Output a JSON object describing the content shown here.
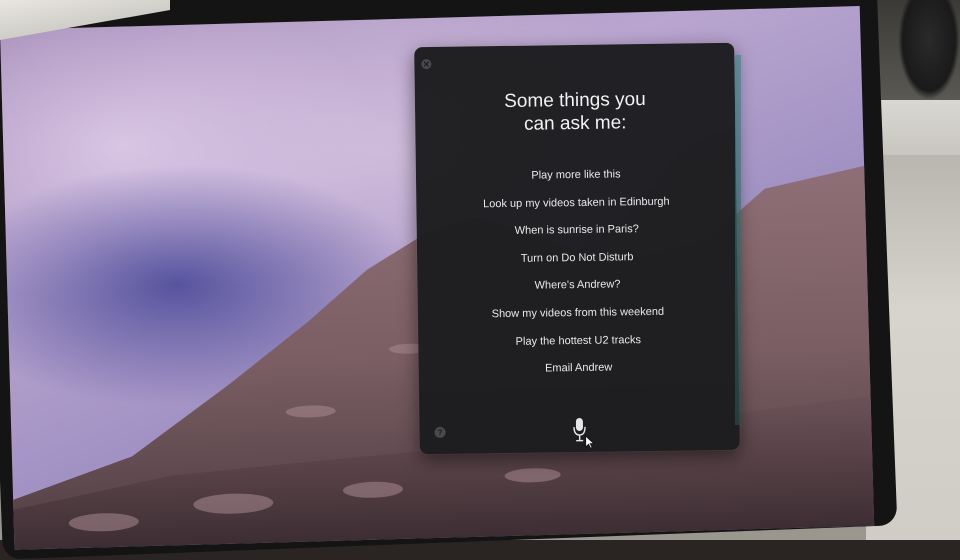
{
  "siri": {
    "title_line1": "Some things you",
    "title_line2": "can ask me:",
    "suggestions": [
      "Play more like this",
      "Look up my videos taken in Edinburgh",
      "When is sunrise in Paris?",
      "Turn on Do Not Disturb",
      "Where's Andrew?",
      "Show my videos from this weekend",
      "Play the hottest U2 tracks",
      "Email Andrew"
    ],
    "help_label": "?",
    "icons": {
      "close": "close-icon",
      "microphone": "microphone-icon",
      "cursor": "cursor-icon",
      "help": "help-icon"
    }
  },
  "colors": {
    "panel_bg": "#1c1c1e",
    "panel_text": "#f2f2f2",
    "wallpaper_sky": "#a78fb9",
    "wallpaper_mountain": "#7a5e63"
  }
}
